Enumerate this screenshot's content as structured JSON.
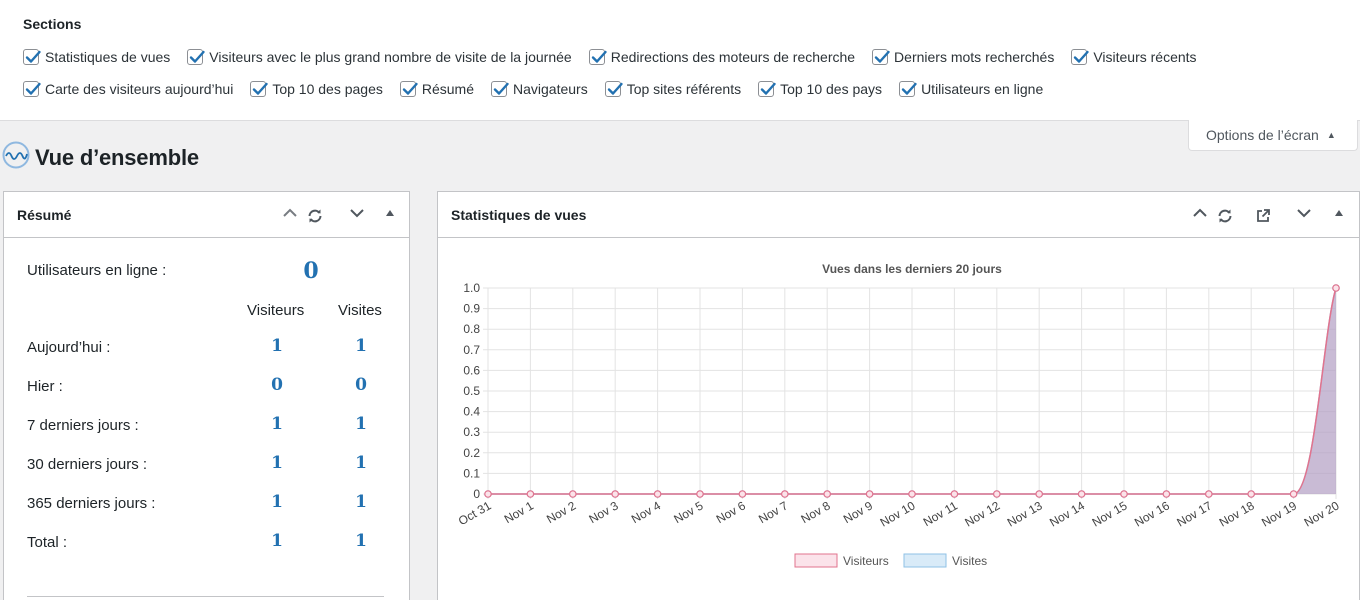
{
  "screen_options": {
    "title": "Sections",
    "row1": [
      "Statistiques de vues",
      "Visiteurs avec le plus grand nombre de visite de la journée",
      "Redirections des moteurs de recherche",
      "Derniers mots recherchés",
      "Visiteurs récents"
    ],
    "row2": [
      "Carte des visiteurs aujourd’hui",
      "Top 10 des pages",
      "Résumé",
      "Navigateurs",
      "Top sites référents",
      "Top 10 des pays",
      "Utilisateurs en ligne"
    ],
    "tab_label": "Options de l’écran"
  },
  "page": {
    "title": "Vue d’ensemble"
  },
  "summary": {
    "title": "Résumé",
    "online_label": "Utilisateurs en ligne :",
    "online_value": "0",
    "col_visitors": "Visiteurs",
    "col_visits": "Visites",
    "rows": [
      {
        "label": "Aujourd’hui :",
        "visitors": "1",
        "visits": "1"
      },
      {
        "label": "Hier :",
        "visitors": "0",
        "visits": "0"
      },
      {
        "label": "7 derniers jours :",
        "visitors": "1",
        "visits": "1"
      },
      {
        "label": "30 derniers jours :",
        "visitors": "1",
        "visits": "1"
      },
      {
        "label": "365 derniers jours :",
        "visitors": "1",
        "visits": "1"
      },
      {
        "label": "Total :",
        "visitors": "1",
        "visits": "1"
      }
    ]
  },
  "stats": {
    "title": "Statistiques de vues"
  },
  "chart_data": {
    "type": "area",
    "title": "Vues dans les derniers 20 jours",
    "categories": [
      "Oct 31",
      "Nov 1",
      "Nov 2",
      "Nov 3",
      "Nov 4",
      "Nov 5",
      "Nov 6",
      "Nov 7",
      "Nov 8",
      "Nov 9",
      "Nov 10",
      "Nov 11",
      "Nov 12",
      "Nov 13",
      "Nov 14",
      "Nov 15",
      "Nov 16",
      "Nov 17",
      "Nov 18",
      "Nov 19",
      "Nov 20"
    ],
    "series": [
      {
        "name": "Visiteurs",
        "values": [
          0,
          0,
          0,
          0,
          0,
          0,
          0,
          0,
          0,
          0,
          0,
          0,
          0,
          0,
          0,
          0,
          0,
          0,
          0,
          0,
          1
        ],
        "color": "#e2738d"
      },
      {
        "name": "Visites",
        "values": [
          0,
          0,
          0,
          0,
          0,
          0,
          0,
          0,
          0,
          0,
          0,
          0,
          0,
          0,
          0,
          0,
          0,
          0,
          0,
          0,
          1
        ],
        "color": "#8fc1e6"
      }
    ],
    "ylim": [
      0,
      1
    ],
    "yticks": [
      "0",
      "0.1",
      "0.2",
      "0.3",
      "0.4",
      "0.5",
      "0.6",
      "0.7",
      "0.8",
      "0.9",
      "1.0"
    ],
    "grid": true,
    "legend": "bottom"
  },
  "colors": {
    "accent": "#2271b1",
    "checkbox": "#2271b1"
  },
  "icons": {
    "logo": "wave-logo-icon",
    "refresh": "refresh-icon",
    "external": "external-link-icon"
  }
}
